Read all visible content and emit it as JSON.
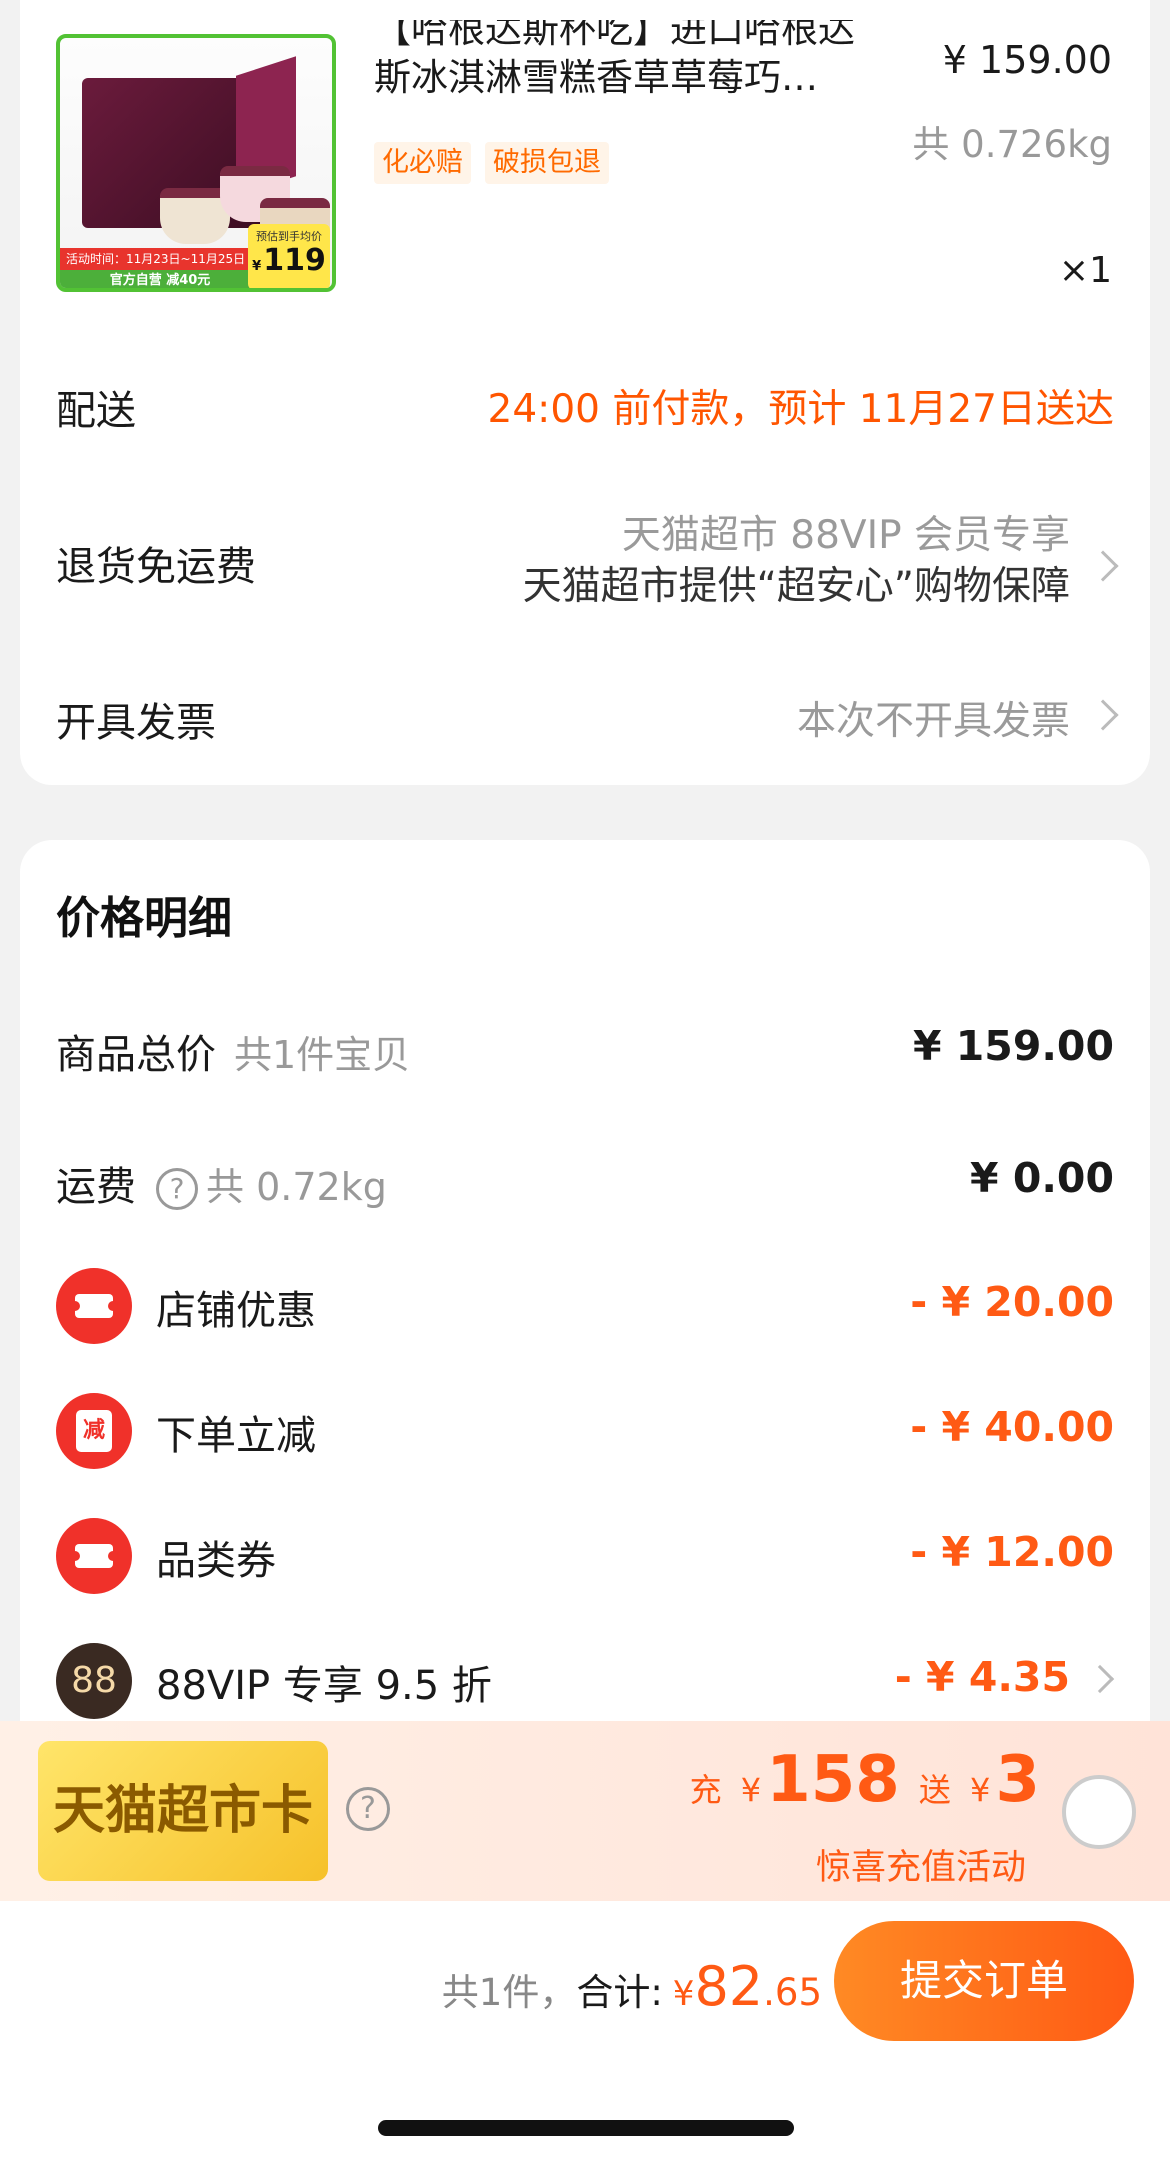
{
  "product": {
    "title_line1": "【哈根达斯杯吃】进口哈根达",
    "title_line2": "斯冰淇淋雪糕香草草莓巧…",
    "tags": [
      "化必赔",
      "破损包退"
    ],
    "price": "¥ 159.00",
    "weight": "共 0.726kg",
    "qty": "×1",
    "thumb": {
      "ribbon": "活动时间：11月23日~11月25日",
      "ribbon2": "官方自营  减40元",
      "tag_label": "预估到手均价",
      "tag_currency": "¥",
      "tag_value": "119"
    }
  },
  "delivery": {
    "label": "配送",
    "value": "24:00 前付款，预计 11月27日送达"
  },
  "return": {
    "label": "退货免运费",
    "line1": "天猫超市 88VIP 会员专享",
    "line2": "天猫超市提供“超安心”购物保障"
  },
  "invoice": {
    "label": "开具发票",
    "value": "本次不开具发票"
  },
  "price_detail": {
    "title": "价格明细",
    "goods": {
      "label": "商品总价",
      "sub": "共1件宝贝",
      "amount": "¥ 159.00"
    },
    "freight": {
      "label": "运费",
      "sub": "共 0.72kg",
      "amount": "¥ 0.00"
    },
    "discounts": [
      {
        "label": "店铺优惠",
        "amount": "- ¥ 20.00",
        "icon": "ticket-icon"
      },
      {
        "label": "下单立减",
        "amount": "- ¥ 40.00",
        "icon": "jian-icon",
        "icon_text": "减"
      },
      {
        "label": "品类券",
        "amount": "- ¥ 12.00",
        "icon": "ticket-icon"
      },
      {
        "label": "88VIP 专享 9.5 折",
        "amount": "- ¥ 4.35",
        "icon": "88vip-icon",
        "icon_text": "88"
      }
    ]
  },
  "banner": {
    "card_label": "天猫超市卡",
    "recharge_prefix": "充",
    "currency": "¥",
    "recharge_amount": "158",
    "gift_prefix": "送",
    "gift_amount": "3",
    "sub": "惊喜充值活动"
  },
  "footer": {
    "count": "共1件，",
    "total_label": "合计:",
    "currency": "¥",
    "total_int": "82",
    "total_dec": ".65",
    "submit": "提交订单"
  },
  "colors": {
    "accent": "#ff5a14",
    "brand_green": "#52c234",
    "card_yellow": "#f6c12a"
  }
}
